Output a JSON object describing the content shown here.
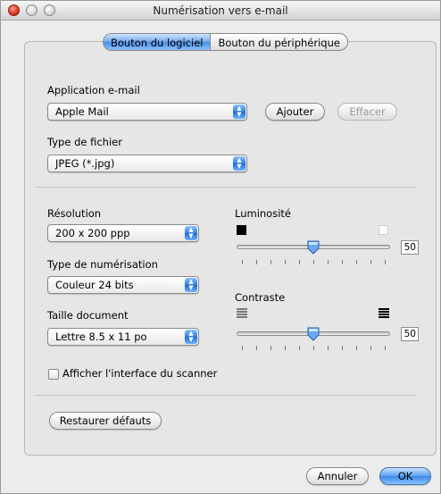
{
  "window": {
    "title": "Numérisation vers e-mail"
  },
  "tabs": [
    {
      "label": "Bouton du logiciel",
      "active": true
    },
    {
      "label": "Bouton du périphérique",
      "active": false
    }
  ],
  "email_app": {
    "label": "Application e-mail",
    "selected": "Apple Mail",
    "add_label": "Ajouter",
    "delete_label": "Effacer"
  },
  "file_type": {
    "label": "Type de fichier",
    "selected": "JPEG (*.jpg)"
  },
  "resolution": {
    "label": "Résolution",
    "selected": "200 x 200 ppp"
  },
  "scan_type": {
    "label": "Type de numérisation",
    "selected": "Couleur 24 bits"
  },
  "doc_size": {
    "label": "Taille document",
    "selected": "Lettre  8.5 x 11 po"
  },
  "brightness": {
    "label": "Luminosité",
    "value": "50",
    "level": 50
  },
  "contrast": {
    "label": "Contraste",
    "value": "50",
    "level": 50
  },
  "show_scanner_ui": {
    "label": "Afficher l'interface du scanner",
    "checked": false
  },
  "restore_label": "Restaurer défauts",
  "cancel_label": "Annuler",
  "ok_label": "OK",
  "icons": {
    "window_close": "close-dot-icon",
    "window_minimize": "minimize-dot-icon",
    "window_zoom": "zoom-dot-icon",
    "popup_arrows": "up-down-arrows-icon",
    "brightness_low": "black-square-icon",
    "brightness_high": "white-square-icon",
    "contrast_low": "low-contrast-lines-icon",
    "contrast_high": "high-contrast-lines-icon"
  },
  "colors": {
    "accent": "#3b87e6",
    "window_bg": "#ececec"
  }
}
